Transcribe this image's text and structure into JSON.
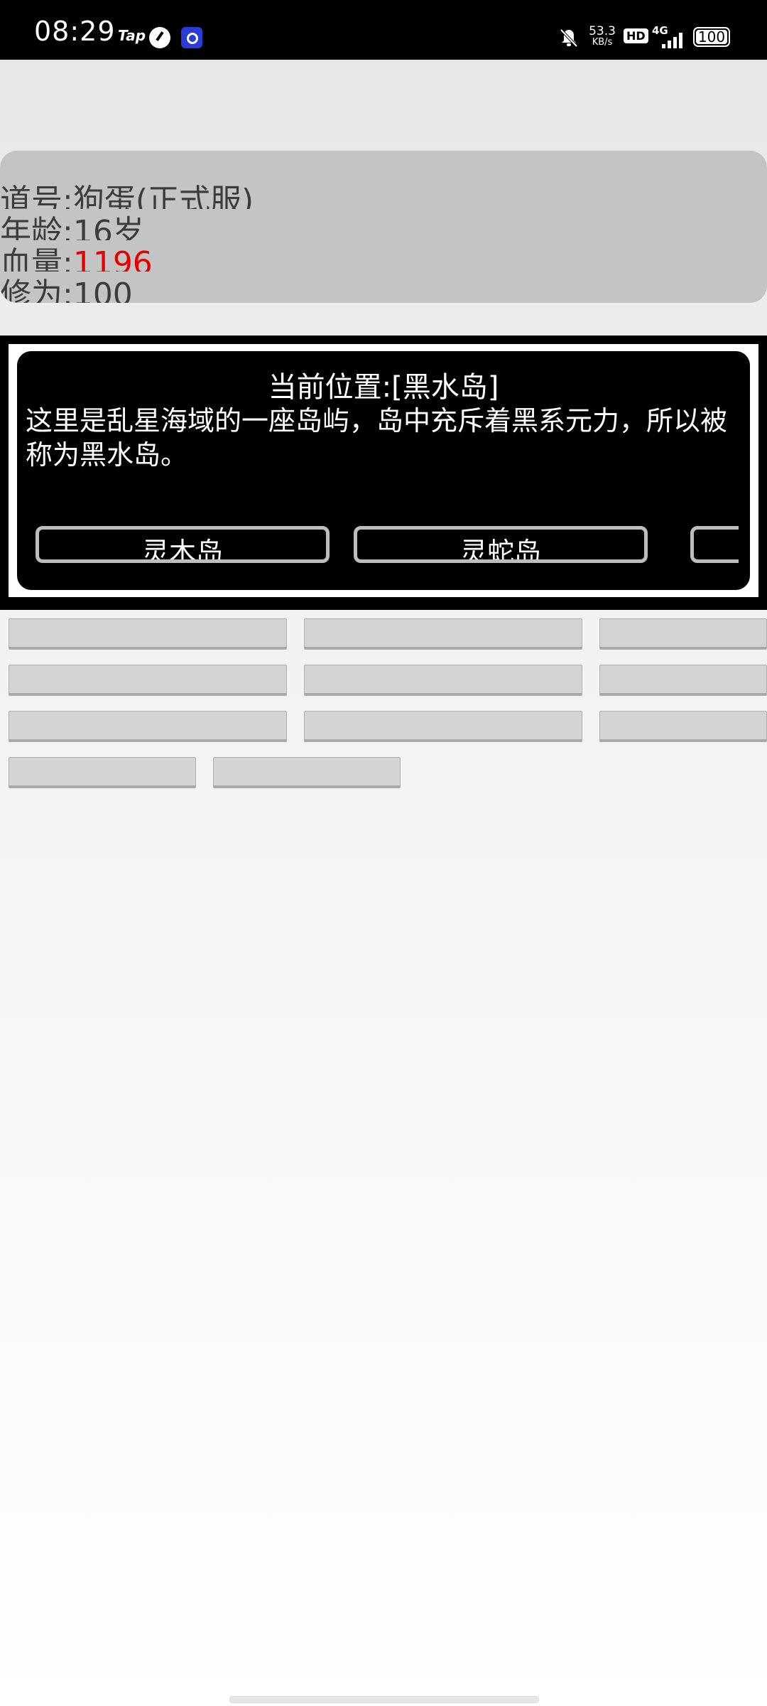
{
  "status_bar": {
    "time": "08:29",
    "tap_label": "Tap",
    "net_speed_value": "53.3",
    "net_speed_unit": "KB/s",
    "hd": "HD",
    "network": "4G",
    "battery": "100",
    "icons": [
      "gauge-icon",
      "app-icon",
      "bell-mute-icon",
      "signal-icon",
      "battery-icon"
    ]
  },
  "player": {
    "title_line": "道号:狗蛋(正式服)",
    "age_line": "年龄:16岁",
    "hp_label": "血量:",
    "hp_value": "1196",
    "cultivation_line": "修为:100"
  },
  "location": {
    "title": "当前位置:[黑水岛]",
    "description": "这里是乱星海域的一座岛屿，岛中充斥着黑系元力，所以被称为黑水岛。",
    "destinations": [
      "灵木岛",
      "灵蛇岛",
      ""
    ]
  },
  "colors": {
    "hp_value": "#e50000",
    "panel": "#c4c4c4",
    "card_bg": "#000000",
    "button_bg": "#d3d3d3"
  }
}
